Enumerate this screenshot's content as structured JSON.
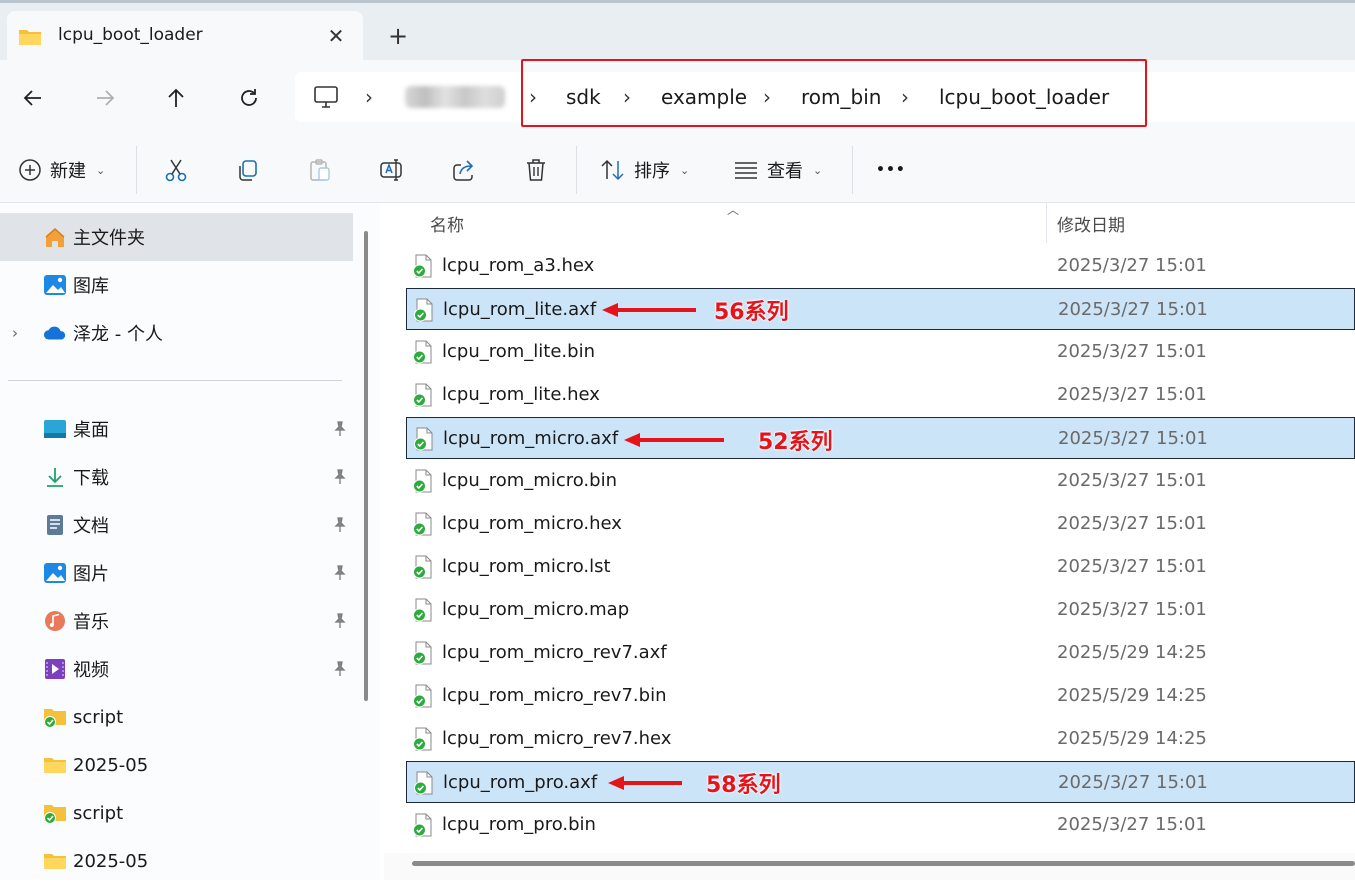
{
  "tab": {
    "title": "lcpu_boot_loader",
    "close": "✕",
    "new_tab": "+"
  },
  "breadcrumb": {
    "items": [
      "sdk",
      "example",
      "rom_bin",
      "lcpu_boot_loader"
    ],
    "separator": "›"
  },
  "toolbar": {
    "new_label": "新建",
    "sort_label": "排序",
    "view_label": "查看",
    "more": "•••"
  },
  "sidebar": {
    "home": "主文件夹",
    "gallery": "图库",
    "onedrive": "泽龙 - 个人",
    "quick_access": [
      {
        "label": "桌面",
        "icon": "desktop-icon",
        "pinned": true
      },
      {
        "label": "下载",
        "icon": "download-icon",
        "pinned": true
      },
      {
        "label": "文档",
        "icon": "documents-icon",
        "pinned": true
      },
      {
        "label": "图片",
        "icon": "pictures-icon",
        "pinned": true
      },
      {
        "label": "音乐",
        "icon": "music-icon",
        "pinned": true
      },
      {
        "label": "视频",
        "icon": "videos-icon",
        "pinned": true
      },
      {
        "label": "script",
        "icon": "synced-folder-icon",
        "pinned": false
      },
      {
        "label": "2025-05",
        "icon": "folder-icon",
        "pinned": false
      },
      {
        "label": "script",
        "icon": "synced-folder-icon",
        "pinned": false
      },
      {
        "label": "2025-05",
        "icon": "folder-icon",
        "pinned": false
      }
    ]
  },
  "columns": {
    "name": "名称",
    "modified": "修改日期"
  },
  "files": [
    {
      "name": "lcpu_rom_a3.hex",
      "date": "2025/3/27 15:01",
      "selected": false
    },
    {
      "name": "lcpu_rom_lite.axf",
      "date": "2025/3/27 15:01",
      "selected": true
    },
    {
      "name": "lcpu_rom_lite.bin",
      "date": "2025/3/27 15:01",
      "selected": false
    },
    {
      "name": "lcpu_rom_lite.hex",
      "date": "2025/3/27 15:01",
      "selected": false
    },
    {
      "name": "lcpu_rom_micro.axf",
      "date": "2025/3/27 15:01",
      "selected": true
    },
    {
      "name": "lcpu_rom_micro.bin",
      "date": "2025/3/27 15:01",
      "selected": false
    },
    {
      "name": "lcpu_rom_micro.hex",
      "date": "2025/3/27 15:01",
      "selected": false
    },
    {
      "name": "lcpu_rom_micro.lst",
      "date": "2025/3/27 15:01",
      "selected": false
    },
    {
      "name": "lcpu_rom_micro.map",
      "date": "2025/3/27 15:01",
      "selected": false
    },
    {
      "name": "lcpu_rom_micro_rev7.axf",
      "date": "2025/5/29 14:25",
      "selected": false
    },
    {
      "name": "lcpu_rom_micro_rev7.bin",
      "date": "2025/5/29 14:25",
      "selected": false
    },
    {
      "name": "lcpu_rom_micro_rev7.hex",
      "date": "2025/5/29 14:25",
      "selected": false
    },
    {
      "name": "lcpu_rom_pro.axf",
      "date": "2025/3/27 15:01",
      "selected": true
    },
    {
      "name": "lcpu_rom_pro.bin",
      "date": "2025/3/27 15:01",
      "selected": false
    }
  ],
  "annotations": [
    "56系列",
    "52系列",
    "58系列"
  ],
  "colors": {
    "selection": "#cce4f7",
    "annotation_red": "#e5141b",
    "accent": "#0067c0"
  }
}
